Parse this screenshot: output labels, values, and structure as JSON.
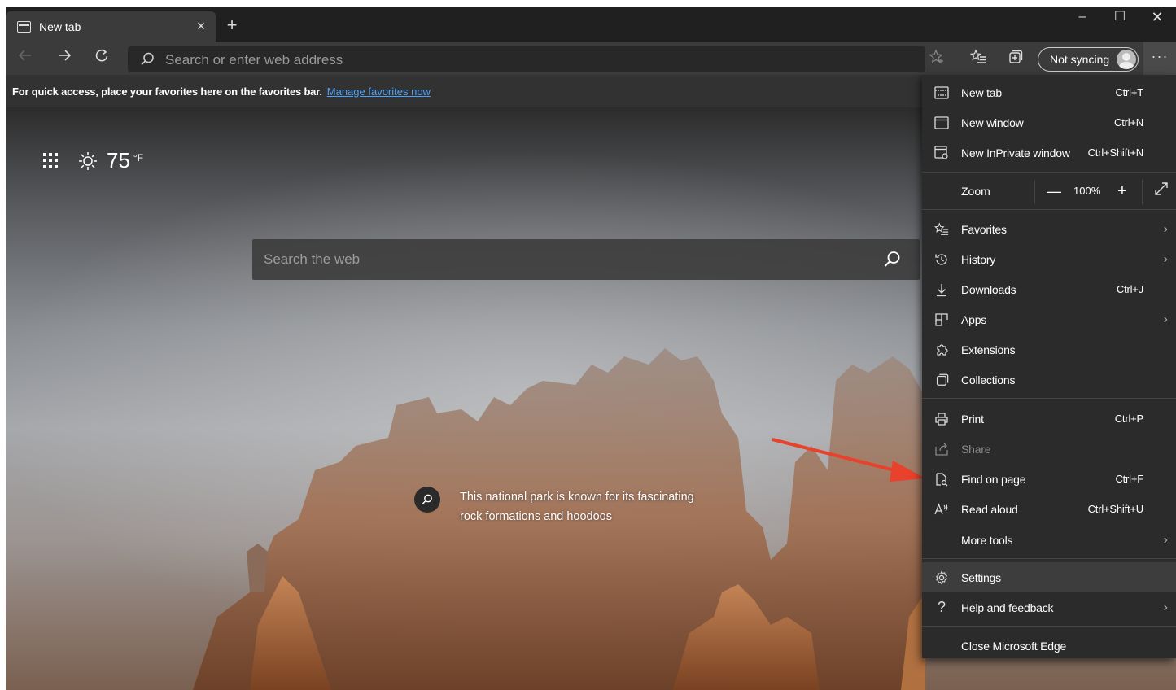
{
  "tab": {
    "title": "New tab",
    "close": "×",
    "new_tab": "+"
  },
  "window_controls": {
    "minimize": "–",
    "maximize": "☐",
    "close": "✕"
  },
  "toolbar": {
    "address_placeholder": "Search or enter web address",
    "sync_label": "Not syncing",
    "more": "···"
  },
  "favorites_bar": {
    "message": "For quick access, place your favorites here on the favorites bar.",
    "link": "Manage favorites now"
  },
  "weather": {
    "temperature": "75",
    "unit": "°F"
  },
  "web_search": {
    "placeholder": "Search the web"
  },
  "image_info": {
    "text": "This national park is known for its fascinating rock formations and hoodoos"
  },
  "menu": {
    "items": [
      {
        "label": "New tab",
        "shortcut": "Ctrl+T"
      },
      {
        "label": "New window",
        "shortcut": "Ctrl+N"
      },
      {
        "label": "New InPrivate window",
        "shortcut": "Ctrl+Shift+N"
      },
      {
        "label": "Favorites"
      },
      {
        "label": "History"
      },
      {
        "label": "Downloads",
        "shortcut": "Ctrl+J"
      },
      {
        "label": "Apps"
      },
      {
        "label": "Extensions"
      },
      {
        "label": "Collections"
      },
      {
        "label": "Print",
        "shortcut": "Ctrl+P"
      },
      {
        "label": "Share"
      },
      {
        "label": "Find on page",
        "shortcut": "Ctrl+F"
      },
      {
        "label": "Read aloud",
        "shortcut": "Ctrl+Shift+U"
      },
      {
        "label": "More tools"
      },
      {
        "label": "Settings"
      },
      {
        "label": "Help and feedback"
      },
      {
        "label": "Close Microsoft Edge"
      }
    ],
    "zoom": {
      "label": "Zoom",
      "value": "100%",
      "minus": "—",
      "plus": "+"
    }
  },
  "colors": {
    "accent_link": "#4fa3f7",
    "annotation_arrow": "#e8412c",
    "menu_bg": "#2b2b2b"
  }
}
